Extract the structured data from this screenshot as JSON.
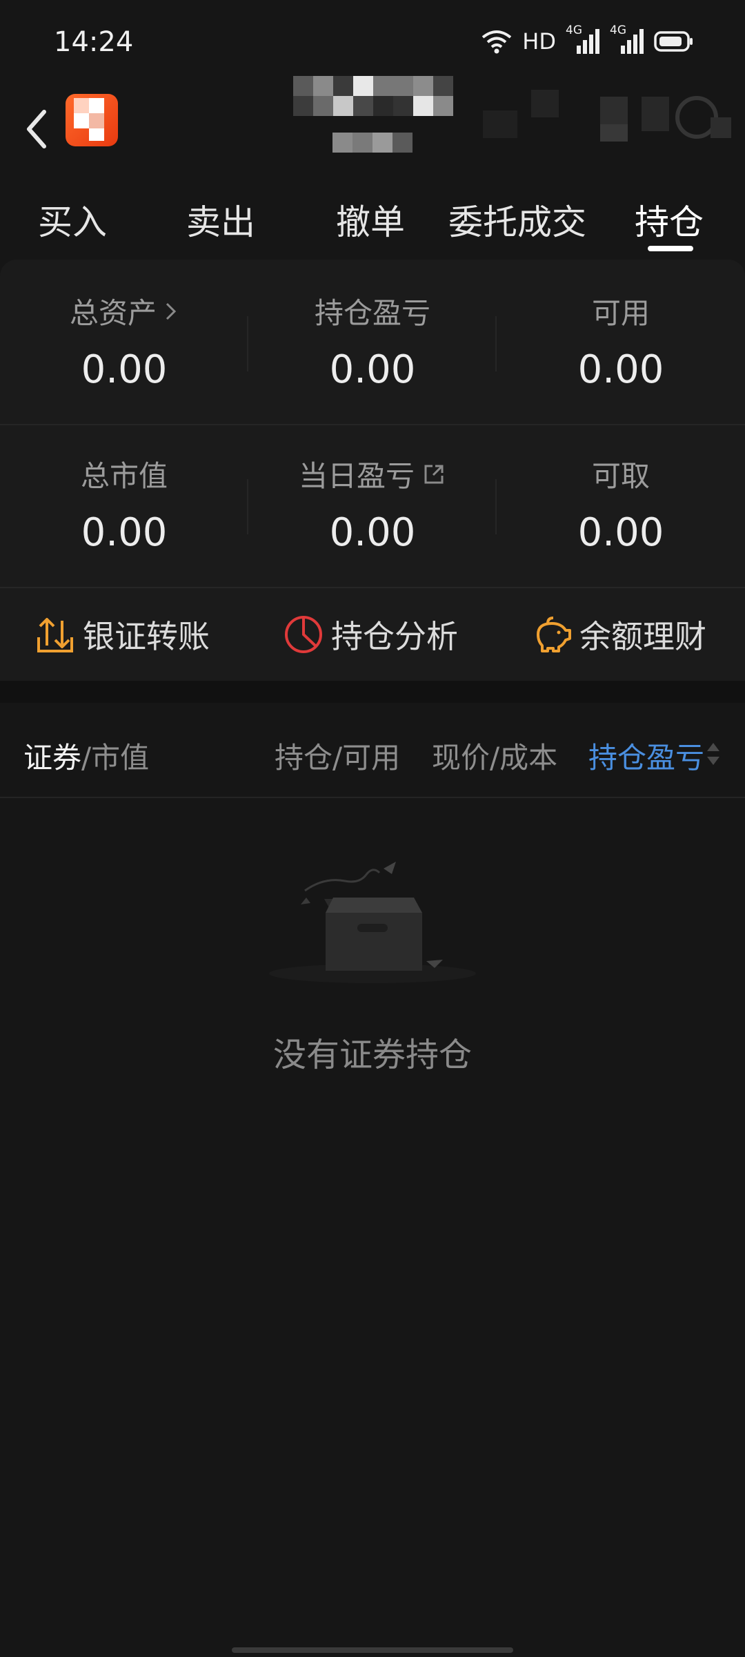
{
  "status_bar": {
    "time": "14:24",
    "hd_label": "HD",
    "network_labels": [
      "4G",
      "4G"
    ],
    "icons": [
      "wifi-icon",
      "signal-icon",
      "signal-icon",
      "battery-icon"
    ]
  },
  "nav": {
    "back_icon": "back-chevron-icon",
    "logo_icon": "app-logo-icon"
  },
  "tabs": [
    {
      "label": "买入",
      "active": false
    },
    {
      "label": "卖出",
      "active": false
    },
    {
      "label": "撤单",
      "active": false
    },
    {
      "label": "委托成交",
      "active": false
    },
    {
      "label": "持仓",
      "active": true
    }
  ],
  "summary": {
    "row1": [
      {
        "label": "总资产",
        "value": "0.00",
        "suffix_icon": "chevron-right-icon"
      },
      {
        "label": "持仓盈亏",
        "value": "0.00"
      },
      {
        "label": "可用",
        "value": "0.00"
      }
    ],
    "row2": [
      {
        "label": "总市值",
        "value": "0.00"
      },
      {
        "label": "当日盈亏",
        "value": "0.00",
        "suffix_icon": "external-link-icon"
      },
      {
        "label": "可取",
        "value": "0.00"
      }
    ]
  },
  "quick_actions": [
    {
      "label": "银证转账",
      "icon": "transfer-icon",
      "color": "#f0a030"
    },
    {
      "label": "持仓分析",
      "icon": "pie-chart-icon",
      "color": "#e03a3a"
    },
    {
      "label": "余额理财",
      "icon": "piggy-bank-icon",
      "color": "#f0a030"
    }
  ],
  "table_header": {
    "col1_main": "证券",
    "col1_sub": "/市值",
    "col2": "持仓/可用",
    "col3": "现价/成本",
    "col4": "持仓盈亏",
    "col4_icon": "sort-arrows-icon",
    "active_color": "#4a8fe0"
  },
  "empty_state": {
    "icon": "empty-box-icon",
    "text": "没有证券持仓"
  }
}
